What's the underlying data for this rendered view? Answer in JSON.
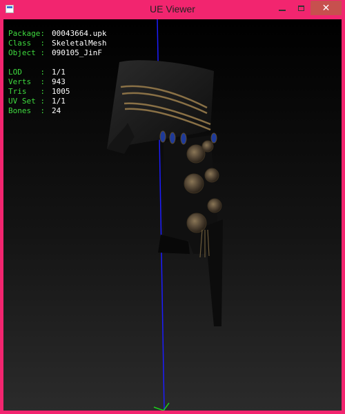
{
  "window": {
    "title": "UE Viewer"
  },
  "info": {
    "package_label": "Package:",
    "package_value": "00043664.upk",
    "class_label": "Class  :",
    "class_value": "SkeletalMesh",
    "object_label": "Object :",
    "object_value": "090105_JinF",
    "lod_label": "LOD    :",
    "lod_value": "1/1",
    "verts_label": "Verts  :",
    "verts_value": "943",
    "tris_label": "Tris   :",
    "tris_value": "1005",
    "uvset_label": "UV Set :",
    "uvset_value": "1/1",
    "bones_label": "Bones  :",
    "bones_value": "24"
  },
  "colors": {
    "titlebar": "#f2256f",
    "label_green": "#3fdc3f",
    "value_white": "#ffffff",
    "axis_blue": "#1c1cff"
  },
  "icons": {
    "app": "app-icon",
    "minimize": "minimize-icon",
    "maximize": "maximize-icon",
    "close": "close-icon"
  }
}
